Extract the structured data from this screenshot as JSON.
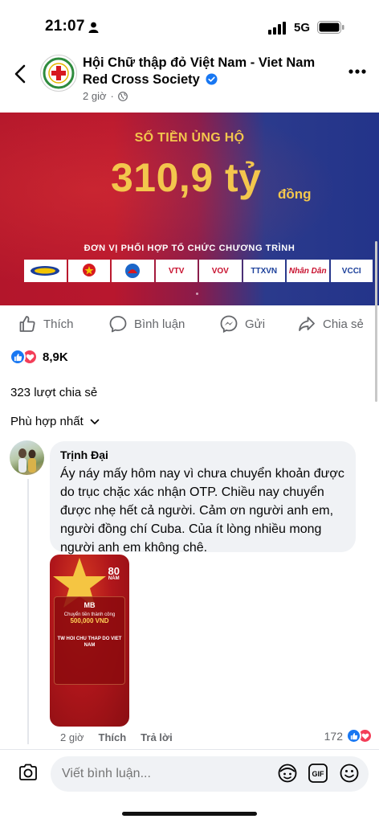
{
  "status_bar": {
    "time": "21:07",
    "network": "5G"
  },
  "header": {
    "page_name": "Hội Chữ thập đỏ Việt Nam - Viet Nam Red Cross Society",
    "post_time": "2 giờ",
    "privacy_icon": "globe-icon",
    "verified": true
  },
  "banner": {
    "caption": "SỐ TIỀN ỦNG HỘ",
    "amount": "310,9 tỷ",
    "unit": "đồng",
    "partners_title": "ĐƠN VỊ PHỐI HỢP TỔ CHỨC CHƯƠNG TRÌNH",
    "partners": [
      "VTV",
      "VOV",
      "TTXVN",
      "Nhân Dân",
      "VCCI"
    ]
  },
  "actions": {
    "like": "Thích",
    "comment": "Bình luận",
    "send": "Gửi",
    "share": "Chia sẻ"
  },
  "reactions": {
    "count": "8,9K"
  },
  "shares": "323 lượt chia sẻ",
  "sort_label": "Phù hợp nhất",
  "comment": {
    "author": "Trịnh Đại",
    "text": "Áy náy mấy hôm nay vì chưa chuyển khoản được do trục chặc xác nhận OTP. Chiều nay chuyển được nhẹ hết cả người. Cảm ơn người anh em, người đồng chí Cuba. Của ít lòng nhiều mong người anh em không chê.",
    "time": "2 giờ",
    "like_label": "Thích",
    "reply_label": "Trả lời",
    "reaction_count": "172",
    "attachment": {
      "badge_top": "80",
      "badge_bottom": "NĂM",
      "bank": "MB",
      "status": "Chuyển tiền thành công",
      "amount": "500,000 VND",
      "recipient": "TW HOI CHU THAP DO VIET NAM"
    }
  },
  "composer": {
    "placeholder": "Viết bình luận..."
  },
  "colors": {
    "accent": "#1877f2",
    "love": "#f33e58",
    "banner_gold": "#f3c64d"
  }
}
